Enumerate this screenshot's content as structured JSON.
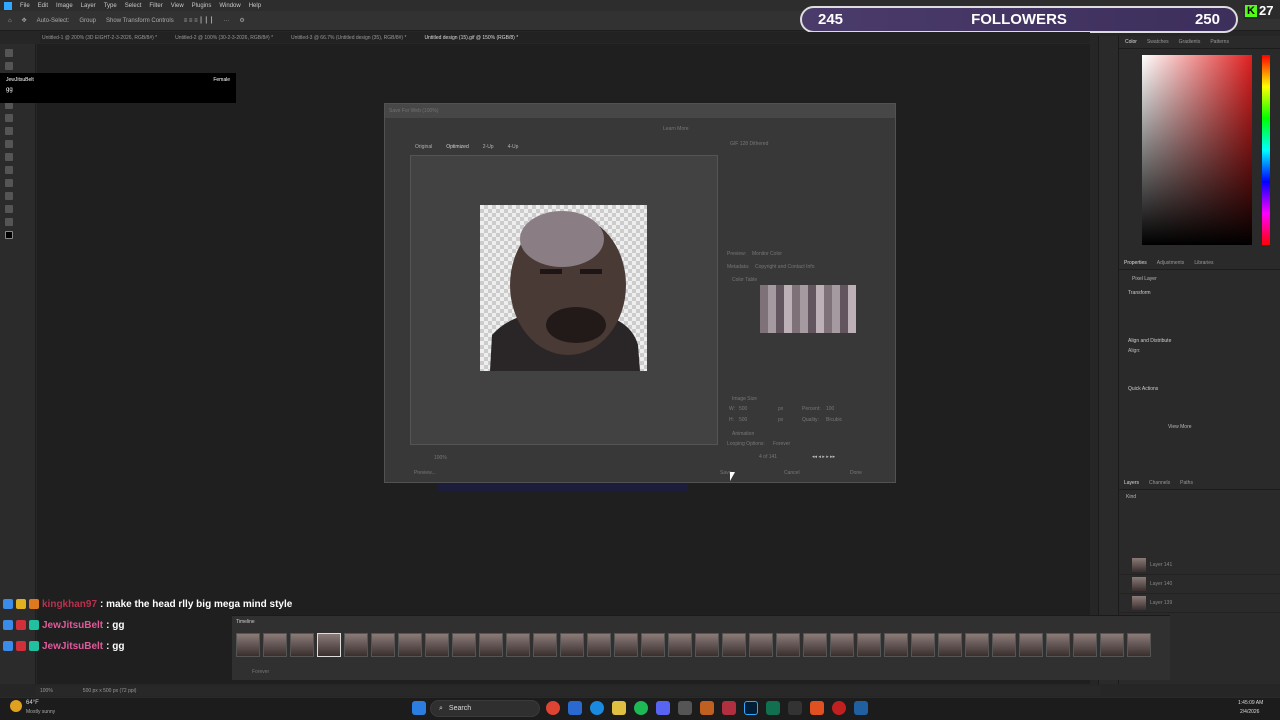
{
  "menu": [
    "File",
    "Edit",
    "Image",
    "Layer",
    "Type",
    "Select",
    "Filter",
    "View",
    "Plugins",
    "Window",
    "Help"
  ],
  "options": {
    "auto_select": "Auto-Select:",
    "group": "Group",
    "show_transform": "Show Transform Controls"
  },
  "doc_tabs": [
    "Untitled-1 @ 200% (3D EIGHT-2-3-2026, RGB/8#) *",
    "Untitled-2 @ 100% (30-2-3-2026, RGB/8#) *",
    "Untitled-3 @ 66.7% (Untitled design (35), RGB/8#) *",
    "Untitled design (15).gif @ 150% (RGB/8) *"
  ],
  "followers": {
    "current": "245",
    "label": "FOLLOWERS",
    "goal": "250"
  },
  "kick": {
    "count": "27"
  },
  "chat_header": {
    "user": "JewJitsuBelt",
    "tag": "Female",
    "msg": "gg"
  },
  "dialog": {
    "title": "Save For Web (100%)",
    "tabs": [
      "Original",
      "Optimized",
      "2-Up",
      "4-Up"
    ],
    "preset": "GIF 128 Dithered",
    "preview_label": "Preview:",
    "preview_value": "Monitor Color",
    "metadata_label": "Metadata:",
    "metadata_value": "Copyright and Contact Info",
    "color_table": "Color Table",
    "image_size": "Image Size",
    "w_label": "W:",
    "w_value": "500",
    "h_label": "H:",
    "h_value": "500",
    "px": "px",
    "percent_label": "Percent:",
    "percent_value": "100",
    "quality_label": "Quality:",
    "quality_value": "Bicubic",
    "animation": "Animation",
    "looping_label": "Looping Options:",
    "looping_value": "Forever",
    "frame_counter": "4 of 141",
    "learn_more": "Learn More",
    "btn_preview": "Preview...",
    "btn_save": "Save...",
    "btn_cancel": "Cancel",
    "btn_done": "Done",
    "zoom": "100%"
  },
  "chat": [
    {
      "user": "kingkhan97",
      "msg": ": make the head rlly big mega mind style",
      "color": "#b8324d"
    },
    {
      "user": "JewJitsuBelt",
      "msg": ": gg",
      "color": "#e05a9a"
    },
    {
      "user": "JewJitsuBelt",
      "msg": ": gg",
      "color": "#e05a9a"
    }
  ],
  "panels": {
    "color_tabs": [
      "Color",
      "Swatches",
      "Gradients",
      "Patterns"
    ],
    "props_tabs": [
      "Properties",
      "Adjustments",
      "Libraries"
    ],
    "pixel_layer": "Pixel Layer",
    "transform": "Transform",
    "align": "Align and Distribute",
    "align_sub": "Align:",
    "quick_actions": "Quick Actions",
    "view_more": "View More",
    "layers_tabs": [
      "Layers",
      "Channels",
      "Paths"
    ],
    "kind": "Kind",
    "layers": [
      "Layer 141",
      "Layer 140",
      "Layer 139"
    ]
  },
  "timeline": {
    "title": "Timeline",
    "loop": "Forever"
  },
  "status": {
    "zoom": "100%",
    "size": "500 px x 500 px (72 ppi)"
  },
  "taskbar": {
    "weather_temp": "64°F",
    "weather_desc": "Mostly sunny",
    "search": "Search",
    "time": "1:45:09 AM",
    "date": "2/4/2026"
  }
}
